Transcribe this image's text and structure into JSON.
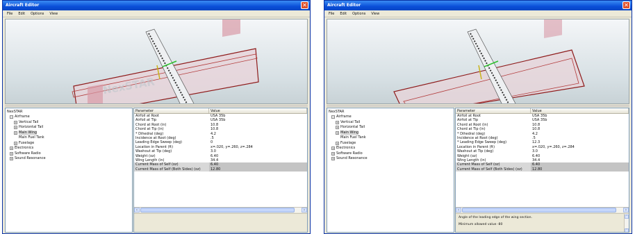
{
  "window_title": "Aircraft Editor",
  "close_glyph": "✕",
  "menu": [
    "File",
    "Edit",
    "Options",
    "View"
  ],
  "tree": {
    "root": "NexSTAR",
    "items": [
      {
        "label": "Airframe",
        "indent": 1,
        "expander": "−"
      },
      {
        "label": "Vertical Tail",
        "indent": 2,
        "expander": "+"
      },
      {
        "label": "Horizontal Tail",
        "indent": 2,
        "expander": "+"
      },
      {
        "label": "Main Wing",
        "indent": 2,
        "expander": "+",
        "selected": true
      },
      {
        "label": "Main Fuel Tank",
        "indent": 2,
        "expander": ""
      },
      {
        "label": "Fuselage",
        "indent": 2,
        "expander": "+"
      },
      {
        "label": "Electronics",
        "indent": 1,
        "expander": "+"
      },
      {
        "label": "Software Radio",
        "indent": 1,
        "expander": "+"
      },
      {
        "label": "Sound Resonance",
        "indent": 1,
        "expander": "+"
      }
    ]
  },
  "grid": {
    "header_parameter": "Parameter",
    "header_value": "Value"
  },
  "left": {
    "rows": [
      {
        "p": "Airfoil at Root",
        "v": "USA 35b"
      },
      {
        "p": "Airfoil at Tip",
        "v": "USA 35b"
      },
      {
        "p": "Chord at Root (in)",
        "v": "10.8"
      },
      {
        "p": "Chord at Tip (in)",
        "v": "10.8"
      },
      {
        "p": "* Dihedral (deg)",
        "v": "4.2"
      },
      {
        "p": "Incidence at Root (deg)",
        "v": ".5"
      },
      {
        "p": "Leading Edge Sweep (deg)",
        "v": "0"
      },
      {
        "p": "Location in Parent (ft)",
        "v": "x=.020, y=.260, z=.284"
      },
      {
        "p": "Washout at Tip (deg)",
        "v": "3.0"
      },
      {
        "p": "Weight (oz)",
        "v": "6.40"
      },
      {
        "p": "Wing Length (in)",
        "v": "34.4"
      },
      {
        "p": "Current Mass of Self (oz)",
        "v": "6.40",
        "hl": true
      },
      {
        "p": "Current Mass of Self (Both Sides) (oz)",
        "v": "12.80",
        "hl": true
      }
    ],
    "desc_line1": "",
    "desc_line2": ""
  },
  "right": {
    "rows": [
      {
        "p": "Airfoil at Root",
        "v": "USA 35b"
      },
      {
        "p": "Airfoil at Tip",
        "v": "USA 35b"
      },
      {
        "p": "Chord at Root (in)",
        "v": "10.8"
      },
      {
        "p": "Chord at Tip (in)",
        "v": "10.8"
      },
      {
        "p": "* Dihedral (deg)",
        "v": "4.2"
      },
      {
        "p": "Incidence at Root (deg)",
        "v": ".5"
      },
      {
        "p": "* Leading Edge Sweep (deg)",
        "v": "12.3"
      },
      {
        "p": "Location in Parent (ft)",
        "v": "x=.020, y=.260, z=.284"
      },
      {
        "p": "Washout at Tip (deg)",
        "v": "3.0"
      },
      {
        "p": "Weight (oz)",
        "v": "6.40"
      },
      {
        "p": "Wing Length (in)",
        "v": "34.4"
      },
      {
        "p": "Current Mass of Self (oz)",
        "v": "6.40",
        "hl": true
      },
      {
        "p": "Current Mass of Self (Both Sides) (oz)",
        "v": "12.80",
        "hl": true
      }
    ],
    "desc_line1": "Angle of the leading edge of the wing section.",
    "desc_line2": "Minimum allowed value -80"
  },
  "viewport_watermark": "NexSTAR",
  "colors": {
    "title_blue": "#0a4ed8",
    "wing_outline": "#8e1b1b",
    "wing_fill": "#e8d6dc",
    "fuselage": "#eef0f2"
  }
}
